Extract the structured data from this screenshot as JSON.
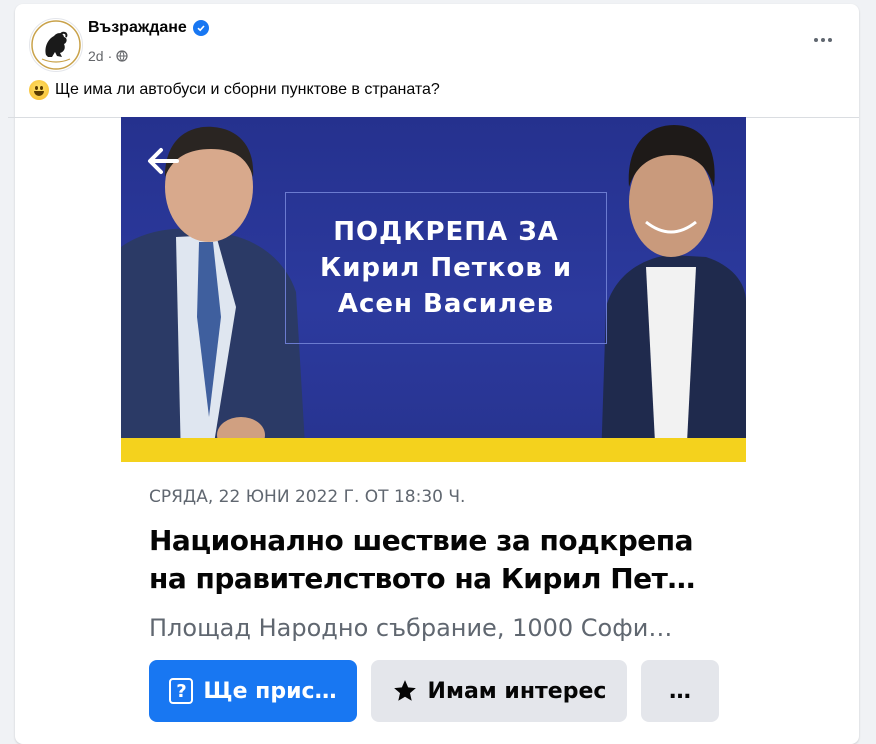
{
  "post": {
    "page_name": "Възраждане",
    "time": "2d",
    "audience_icon": "globe-icon",
    "verified_icon": "verified-badge-icon",
    "text": "Ще има ли автобуси и сборни пунктове в страната?",
    "emoji": "grinning-face-emoji"
  },
  "shared_image": {
    "banner_lines": [
      "ПОДКРЕПА ЗА",
      "Кирил Петков и",
      "Асен Василев"
    ],
    "event": {
      "date": "СРЯДА, 22 ЮНИ 2022 Г. ОТ 18:30 Ч.",
      "title_line1": "Национално шествие за подкрепа",
      "title_line2": "на правителството на Кирил Пет…",
      "location": "Площад Народно събрание, 1000 Софи…"
    },
    "buttons": {
      "going": "Ще прис…",
      "interested": "Имам интерес",
      "more": "…"
    }
  },
  "colors": {
    "banner_blue": "#25318e",
    "banner_yellow": "#f4d21d",
    "facebook_blue": "#1877f2"
  }
}
